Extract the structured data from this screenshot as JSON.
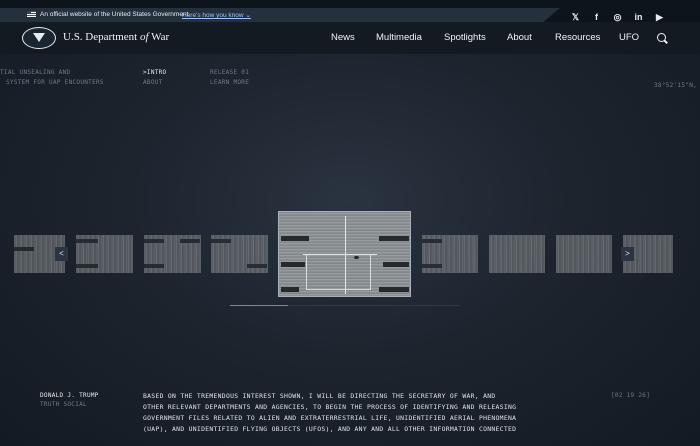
{
  "gov_banner": {
    "text": "An official website of the United States Government",
    "link": "Here's how you know ⌄"
  },
  "social": [
    "𝕏",
    "f",
    "◎",
    "in",
    "▶"
  ],
  "brand": {
    "prefix": "U.S. Department ",
    "of": "of",
    "suffix": " War"
  },
  "nav": [
    "News",
    "Multimedia",
    "Spotlights",
    "About",
    "Resources",
    "UFO"
  ],
  "ufo_page": {
    "title_line1": "TIAL UNSEALING AND",
    "title_line2": "SYSTEM FOR UAP ENCOUNTERS",
    "menu": [
      {
        "label": ">INTRO",
        "active": true
      },
      {
        "label": "ABOUT",
        "active": false
      },
      {
        "label": "RELEASE 01",
        "active": false
      },
      {
        "label": "LEARN MORE",
        "active": false
      }
    ],
    "coords": "38°52'15\"N,",
    "prev_label": "<",
    "next_label": ">",
    "progress": 0.25,
    "quote": {
      "author": "DONALD J. TRUMP",
      "source": "TRUTH SOCIAL",
      "date": "[02 19 26]",
      "lines": [
        "BASED ON THE TREMENDOUS INTEREST SHOWN, I WILL BE DIRECTING THE SECRETARY OF WAR, AND",
        "OTHER RELEVANT DEPARTMENTS AND AGENCIES, TO BEGIN THE PROCESS OF IDENTIFYING AND RELEASING",
        "GOVERNMENT FILES RELATED TO ALIEN AND EXTRATERRESTRIAL LIFE, UNIDENTIFIED AERIAL PHENOMENA",
        "(UAP), AND UNIDENTIFIED FLYING OBJECTS (UFOS), AND ANY AND ALL OTHER INFORMATION CONNECTED"
      ]
    }
  }
}
